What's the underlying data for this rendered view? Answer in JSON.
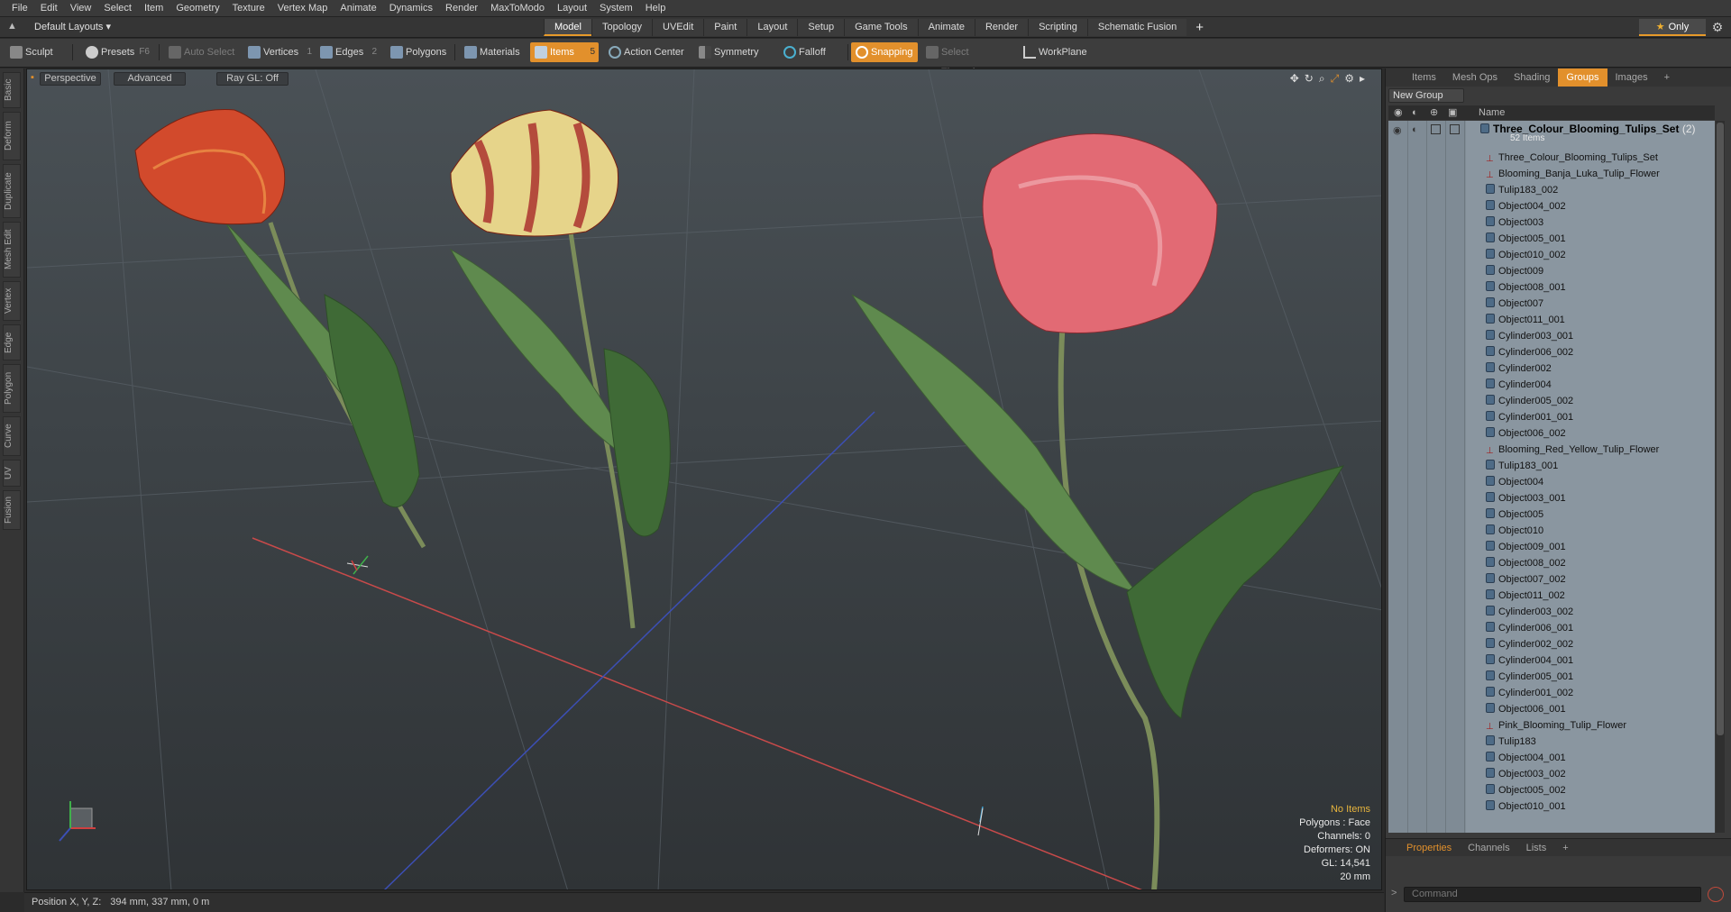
{
  "menu": [
    "File",
    "Edit",
    "View",
    "Select",
    "Item",
    "Geometry",
    "Texture",
    "Vertex Map",
    "Animate",
    "Dynamics",
    "Render",
    "MaxToModo",
    "Layout",
    "System",
    "Help"
  ],
  "layout": {
    "selector": "Default Layouts ▾"
  },
  "mode_tabs": [
    "Model",
    "Topology",
    "UVEdit",
    "Paint",
    "Layout",
    "Setup",
    "Game Tools",
    "Animate",
    "Render",
    "Scripting",
    "Schematic Fusion"
  ],
  "mode_add": "+",
  "only_label": "Only",
  "toolbar": {
    "sculpt": "Sculpt",
    "presets": "Presets",
    "presets_key": "F6",
    "auto_select": "Auto Select",
    "vertices": "Vertices",
    "vertices_count": "1",
    "edges": "Edges",
    "edges_count": "2",
    "polygons": "Polygons",
    "materials": "Materials",
    "items": "Items",
    "items_count": "5",
    "action_center": "Action Center",
    "symmetry": "Symmetry",
    "falloff": "Falloff",
    "snapping": "Snapping",
    "select_through": "Select Through",
    "workplane": "WorkPlane"
  },
  "left_tabs": [
    "Basic",
    "Deform",
    "Duplicate",
    "Mesh Edit",
    "Vertex",
    "Edge",
    "Polygon",
    "Curve",
    "UV",
    "Fusion"
  ],
  "viewport": {
    "view": "Perspective",
    "shading": "Advanced",
    "raygl": "Ray GL: Off",
    "info": {
      "no_items": "No Items",
      "polygons": "Polygons : Face",
      "channels": "Channels: 0",
      "deformers": "Deformers: ON",
      "gl": "GL: 14,541",
      "scale": "20 mm"
    }
  },
  "status": {
    "label": "Position X, Y, Z:",
    "value": "394 mm, 337 mm, 0 m"
  },
  "right_panel": {
    "tabs": [
      "Items",
      "Mesh Ops",
      "Shading",
      "Groups",
      "Images",
      "+"
    ],
    "active_tab": "Groups",
    "new_group": "New Group",
    "column_name": "Name",
    "group_name": "Three_Colour_Blooming_Tulips_Set",
    "group_count": "(2)",
    "group_items": "52 Items",
    "items": [
      {
        "name": "Three_Colour_Blooming_Tulips_Set",
        "type": "loc"
      },
      {
        "name": "Blooming_Banja_Luka_Tulip_Flower",
        "type": "loc"
      },
      {
        "name": "Tulip183_002",
        "type": "mesh"
      },
      {
        "name": "Object004_002",
        "type": "mesh"
      },
      {
        "name": "Object003",
        "type": "mesh"
      },
      {
        "name": "Object005_001",
        "type": "mesh"
      },
      {
        "name": "Object010_002",
        "type": "mesh"
      },
      {
        "name": "Object009",
        "type": "mesh"
      },
      {
        "name": "Object008_001",
        "type": "mesh"
      },
      {
        "name": "Object007",
        "type": "mesh"
      },
      {
        "name": "Object011_001",
        "type": "mesh"
      },
      {
        "name": "Cylinder003_001",
        "type": "mesh"
      },
      {
        "name": "Cylinder006_002",
        "type": "mesh"
      },
      {
        "name": "Cylinder002",
        "type": "mesh"
      },
      {
        "name": "Cylinder004",
        "type": "mesh"
      },
      {
        "name": "Cylinder005_002",
        "type": "mesh"
      },
      {
        "name": "Cylinder001_001",
        "type": "mesh"
      },
      {
        "name": "Object006_002",
        "type": "mesh"
      },
      {
        "name": "Blooming_Red_Yellow_Tulip_Flower",
        "type": "loc"
      },
      {
        "name": "Tulip183_001",
        "type": "mesh"
      },
      {
        "name": "Object004",
        "type": "mesh"
      },
      {
        "name": "Object003_001",
        "type": "mesh"
      },
      {
        "name": "Object005",
        "type": "mesh"
      },
      {
        "name": "Object010",
        "type": "mesh"
      },
      {
        "name": "Object009_001",
        "type": "mesh"
      },
      {
        "name": "Object008_002",
        "type": "mesh"
      },
      {
        "name": "Object007_002",
        "type": "mesh"
      },
      {
        "name": "Object011_002",
        "type": "mesh"
      },
      {
        "name": "Cylinder003_002",
        "type": "mesh"
      },
      {
        "name": "Cylinder006_001",
        "type": "mesh"
      },
      {
        "name": "Cylinder002_002",
        "type": "mesh"
      },
      {
        "name": "Cylinder004_001",
        "type": "mesh"
      },
      {
        "name": "Cylinder005_001",
        "type": "mesh"
      },
      {
        "name": "Cylinder001_002",
        "type": "mesh"
      },
      {
        "name": "Object006_001",
        "type": "mesh"
      },
      {
        "name": "Pink_Blooming_Tulip_Flower",
        "type": "loc"
      },
      {
        "name": "Tulip183",
        "type": "mesh"
      },
      {
        "name": "Object004_001",
        "type": "mesh"
      },
      {
        "name": "Object003_002",
        "type": "mesh"
      },
      {
        "name": "Object005_002",
        "type": "mesh"
      },
      {
        "name": "Object010_001",
        "type": "mesh"
      }
    ],
    "bottom_tabs": [
      "Properties",
      "Channels",
      "Lists",
      "+"
    ],
    "command_placeholder": "Command"
  }
}
